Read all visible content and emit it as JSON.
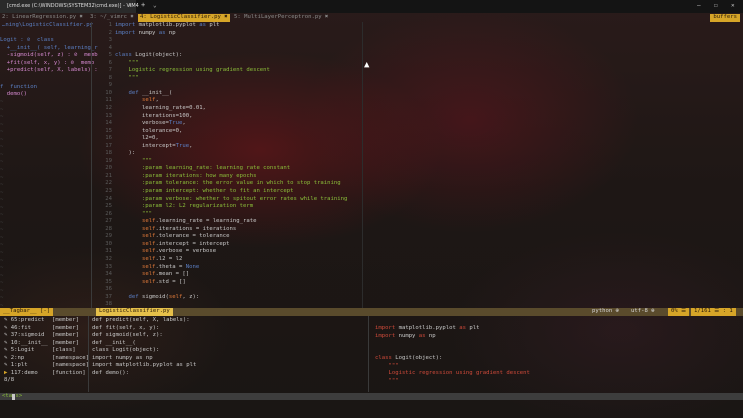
{
  "window": {
    "title": "[cmd.exe (C:\\WINDOWS\\SYSTEM32\\cmd.exe)] - VIM4",
    "new_tab": "+",
    "dropdown": "⌄",
    "close_tab": "×",
    "minimize": "—",
    "maximize": "☐",
    "close": "✕"
  },
  "tabline": {
    "tabs": [
      {
        "label": "2: LinearRegression.py ✖",
        "active": false
      },
      {
        "label": "3: ~/_vimrc ✖",
        "active": false
      },
      {
        "label": "4: LogisticClassifier.py ✖",
        "active": true
      },
      {
        "label": "5: MultiLayerPerceptron.py ✖",
        "active": false
      }
    ],
    "buffers": "buffers"
  },
  "tagbar": {
    "header": "…ning\\LogisticClassifier.py",
    "items": [
      "Logit : ⊘  class",
      "  +__init__( self, learning_r",
      "  -sigmoid(self, z) : ⊘  memb",
      "  +fit(self, x, y) : ⊘  memb",
      "  +predict(self, X, labels) :",
      "",
      "f  function",
      "  demo()"
    ]
  },
  "gutter": [
    "1",
    "2",
    "3",
    "4",
    "5",
    "6",
    "7",
    "8",
    "9",
    "10",
    "11",
    "12",
    "13",
    "14",
    "15",
    "16",
    "17",
    "18",
    "19",
    "20",
    "21",
    "22",
    "23",
    "24",
    "25",
    "26",
    "27",
    "28",
    "29",
    "30",
    "31",
    "32",
    "33",
    "34",
    "35",
    "36",
    "37",
    "38"
  ],
  "code_lines": [
    "import matplotlib.pyplot as plt",
    "import numpy as np",
    "",
    "",
    "class Logit(object):",
    "    \"\"\"",
    "    Logistic regression using gradient descent",
    "    \"\"\"",
    "",
    "    def __init__(",
    "        self,",
    "        learning_rate=0.01,",
    "        iterations=100,",
    "        verbose=True,",
    "        tolerance=0,",
    "        l2=0,",
    "        intercept=True,",
    "    ):",
    "        \"\"\"",
    "        :param learning_rate: learning rate constant",
    "        :param iterations: how many epochs",
    "        :param tolerance: the error value in which to stop training",
    "        :param intercept: whether to fit an intercept",
    "        :param verbose: whether to spitout error rates while training",
    "        :param l2: L2 regularization term",
    "        \"\"\"",
    "        self.learning_rate = learning_rate",
    "        self.iterations = iterations",
    "        self.tolerance = tolerance",
    "        self.intercept = intercept",
    "        self.verbose = verbose",
    "        self.l2 = l2",
    "        self.theta = None",
    "        self.mean = []",
    "        self.std = []",
    "",
    "    def sigmoid(self, z):"
  ],
  "statusline": {
    "mode": "__Tagbar__ [-]",
    "file": "LogisticClassifier.py",
    "filetype": "python ⊕",
    "encoding": "utf-8 ⊕",
    "percent": "0% ☰",
    "position": "1/161 ☰ : 1"
  },
  "bottom_list": [
    {
      "icon": "✎",
      "name": "65:predict",
      "kind": "[member]",
      "sig": "def predict(self, X, labels):"
    },
    {
      "icon": "✎",
      "name": "46:fit",
      "kind": "[member]",
      "sig": "def fit(self, x, y):"
    },
    {
      "icon": "✎",
      "name": "37:sigmoid",
      "kind": "[member]",
      "sig": "def sigmoid(self, z):"
    },
    {
      "icon": "✎",
      "name": "10:__init__",
      "kind": "[member]",
      "sig": "def __init__("
    },
    {
      "icon": "✎",
      "name": "5:Logit",
      "kind": "[class]",
      "sig": "class Logit(object):"
    },
    {
      "icon": "✎",
      "name": "2:np",
      "kind": "[namespace]",
      "sig": "import numpy as np"
    },
    {
      "icon": "✎",
      "name": "1:plt",
      "kind": "[namespace]",
      "sig": "import matplotlib.pyplot as plt"
    },
    {
      "icon": "▶",
      "name": "117:demo",
      "kind": "[function]",
      "sig": "def demo():"
    }
  ],
  "counter": "8/8",
  "prompt": "<tags>",
  "preview_lines": [
    "import matplotlib.pyplot as plt",
    "import numpy as np",
    "",
    "",
    "class Logit(object):",
    "    \"\"\"",
    "    Logistic regression using gradient descent",
    "    \"\"\""
  ]
}
